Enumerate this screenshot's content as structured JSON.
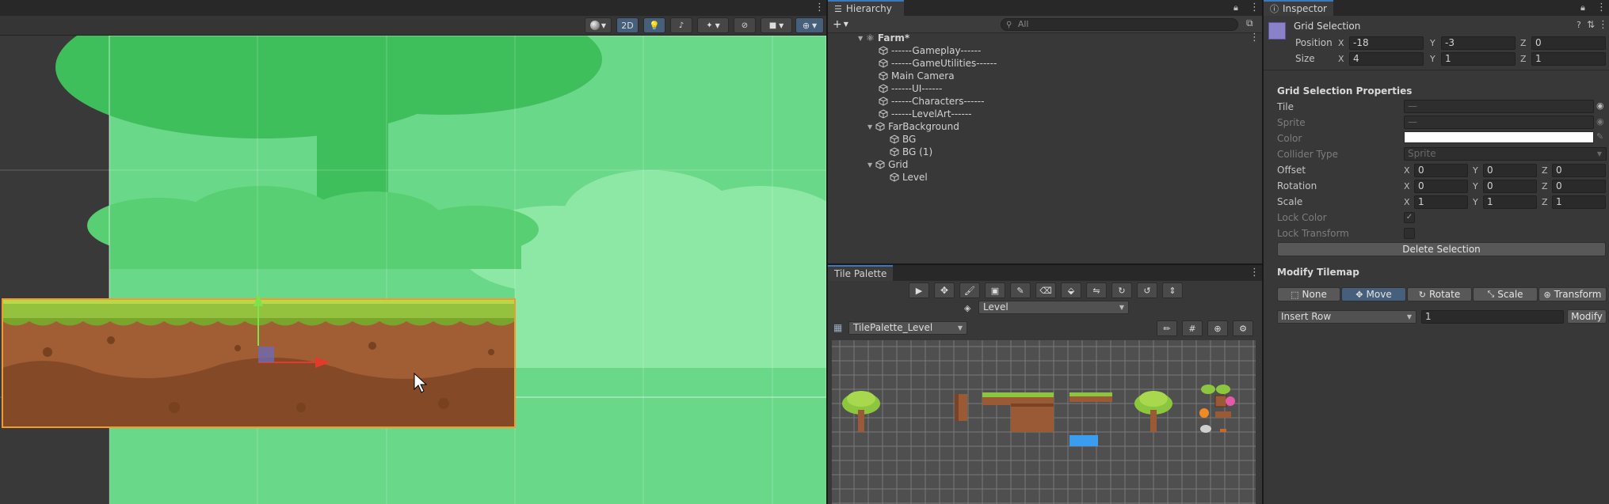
{
  "scene": {
    "toolbar": {
      "mode_2d": "2D"
    }
  },
  "hierarchy": {
    "tab_label": "Hierarchy",
    "add_label": "+",
    "search_placeholder": "All",
    "scene_name": "Farm*",
    "items": [
      {
        "label": "------Gameplay------"
      },
      {
        "label": "------GameUtilities------"
      },
      {
        "label": "Main Camera"
      },
      {
        "label": "------UI------"
      },
      {
        "label": "------Characters------"
      },
      {
        "label": "------LevelArt------"
      },
      {
        "label": "FarBackground"
      },
      {
        "label": "BG"
      },
      {
        "label": "BG (1)"
      },
      {
        "label": "Grid"
      },
      {
        "label": "Level"
      }
    ]
  },
  "palette": {
    "tab_label": "Tile Palette",
    "target_layer": "Level",
    "palette_name": "TilePalette_Level"
  },
  "inspector": {
    "tab_label": "Inspector",
    "object_name": "Grid Selection",
    "position": {
      "label": "Position",
      "x": "-18",
      "y": "-3",
      "z": "0"
    },
    "size": {
      "label": "Size",
      "x": "4",
      "y": "1",
      "z": "1"
    },
    "axis": {
      "x": "X",
      "y": "Y",
      "z": "Z"
    },
    "props_title": "Grid Selection Properties",
    "tile": {
      "label": "Tile",
      "value": "—"
    },
    "sprite": {
      "label": "Sprite",
      "value": "—"
    },
    "color": {
      "label": "Color",
      "value": "#ffffff"
    },
    "collider_type": {
      "label": "Collider Type",
      "value": "Sprite"
    },
    "offset": {
      "label": "Offset",
      "x": "0",
      "y": "0",
      "z": "0"
    },
    "rotation": {
      "label": "Rotation",
      "x": "0",
      "y": "0",
      "z": "0"
    },
    "scale": {
      "label": "Scale",
      "x": "1",
      "y": "1",
      "z": "1"
    },
    "lock_color": {
      "label": "Lock Color",
      "checked": true
    },
    "lock_transform": {
      "label": "Lock Transform",
      "checked": false
    },
    "delete_selection": "Delete Selection",
    "modify_title": "Modify Tilemap",
    "modes": [
      {
        "label": "None",
        "active": false
      },
      {
        "label": "Move",
        "active": true
      },
      {
        "label": "Rotate",
        "active": false
      },
      {
        "label": "Scale",
        "active": false
      },
      {
        "label": "Transform",
        "active": false
      }
    ],
    "insert_row": {
      "option": "Insert Row",
      "value": "1"
    },
    "modify_button": "Modify"
  }
}
